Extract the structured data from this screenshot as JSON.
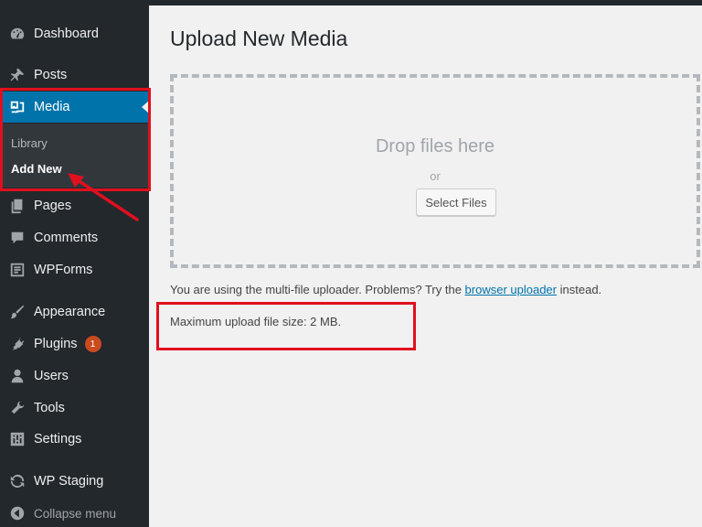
{
  "sidebar": {
    "items": [
      {
        "label": "Dashboard",
        "icon": "dashboard-icon"
      },
      {
        "label": "Posts",
        "icon": "pin-icon"
      },
      {
        "label": "Media",
        "icon": "media-icon",
        "active": true
      },
      {
        "label": "Pages",
        "icon": "pages-icon"
      },
      {
        "label": "Comments",
        "icon": "comment-icon"
      },
      {
        "label": "WPForms",
        "icon": "form-icon"
      },
      {
        "label": "Appearance",
        "icon": "brush-icon"
      },
      {
        "label": "Plugins",
        "icon": "plug-icon",
        "badge": "1"
      },
      {
        "label": "Users",
        "icon": "user-icon"
      },
      {
        "label": "Tools",
        "icon": "wrench-icon"
      },
      {
        "label": "Settings",
        "icon": "settings-icon"
      },
      {
        "label": "WP Staging",
        "icon": "staging-icon"
      },
      {
        "label": "Collapse menu",
        "icon": "collapse-icon"
      }
    ],
    "submenu": [
      {
        "label": "Library"
      },
      {
        "label": "Add New",
        "current": true
      }
    ]
  },
  "main": {
    "title": "Upload New Media",
    "drop_text": "Drop files here",
    "or_text": "or",
    "select_button": "Select Files",
    "info_prefix": "You are using the multi-file uploader. Problems? Try the",
    "info_link": "browser uploader",
    "info_suffix": "instead.",
    "max_size": "Maximum upload file size: 2 MB."
  },
  "colors": {
    "sidebar_bg": "#23282d",
    "active_bg": "#0073aa",
    "annotation_red": "#e0101e",
    "badge": "#ca4a1f"
  }
}
